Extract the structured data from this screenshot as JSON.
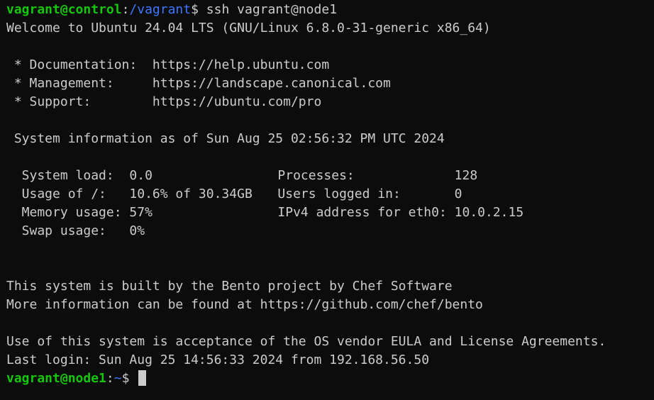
{
  "colors": {
    "background": "#0c0c0c",
    "foreground": "#cccccc",
    "prompt_user": "#16c60c",
    "prompt_path": "#3b78ff"
  },
  "prompt1": {
    "user": "vagrant@control",
    "colon": ":",
    "path": "/vagrant",
    "symbol": "$ ",
    "command": "ssh vagrant@node1"
  },
  "welcome": "Welcome to Ubuntu 24.04 LTS (GNU/Linux 6.8.0-31-generic x86_64)",
  "links": [
    {
      "label": " * Documentation:  ",
      "url": "https://help.ubuntu.com"
    },
    {
      "label": " * Management:     ",
      "url": "https://landscape.canonical.com"
    },
    {
      "label": " * Support:        ",
      "url": "https://ubuntu.com/pro"
    }
  ],
  "sysinfo_header": " System information as of Sun Aug 25 02:56:32 PM UTC 2024",
  "sysinfo": {
    "system_load_label": "  System load:  ",
    "system_load": "0.0",
    "processes_label": "Processes:             ",
    "processes": "128",
    "usage_label": "  Usage of /:   ",
    "usage": "10.6% of 30.34GB",
    "users_label": "Users logged in:       ",
    "users": "0",
    "memory_label": "  Memory usage: ",
    "memory": "57%",
    "ipv4_label": "IPv4 address for eth0: ",
    "ipv4": "10.0.2.15",
    "swap_label": "  Swap usage:   ",
    "swap": "0%"
  },
  "bento_line1": "This system is built by the Bento project by Chef Software",
  "bento_line2": "More information can be found at https://github.com/chef/bento",
  "eula": "Use of this system is acceptance of the OS vendor EULA and License Agreements.",
  "last_login": "Last login: Sun Aug 25 14:56:33 2024 from 192.168.56.50",
  "prompt2": {
    "user": "vagrant@node1",
    "colon": ":",
    "path": "~",
    "symbol": "$ "
  }
}
